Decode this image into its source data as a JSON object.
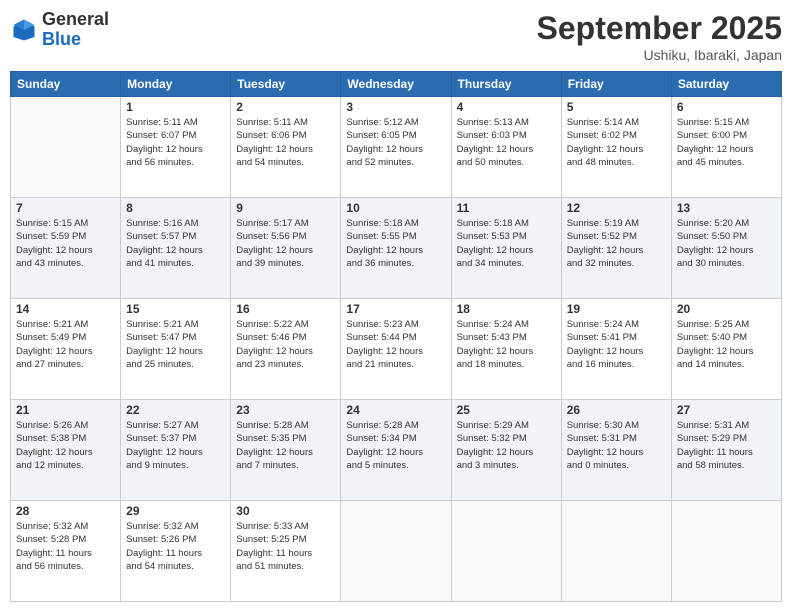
{
  "header": {
    "logo_general": "General",
    "logo_blue": "Blue",
    "month": "September 2025",
    "location": "Ushiku, Ibaraki, Japan"
  },
  "weekdays": [
    "Sunday",
    "Monday",
    "Tuesday",
    "Wednesday",
    "Thursday",
    "Friday",
    "Saturday"
  ],
  "weeks": [
    [
      {
        "day": "",
        "info": ""
      },
      {
        "day": "1",
        "info": "Sunrise: 5:11 AM\nSunset: 6:07 PM\nDaylight: 12 hours\nand 56 minutes."
      },
      {
        "day": "2",
        "info": "Sunrise: 5:11 AM\nSunset: 6:06 PM\nDaylight: 12 hours\nand 54 minutes."
      },
      {
        "day": "3",
        "info": "Sunrise: 5:12 AM\nSunset: 6:05 PM\nDaylight: 12 hours\nand 52 minutes."
      },
      {
        "day": "4",
        "info": "Sunrise: 5:13 AM\nSunset: 6:03 PM\nDaylight: 12 hours\nand 50 minutes."
      },
      {
        "day": "5",
        "info": "Sunrise: 5:14 AM\nSunset: 6:02 PM\nDaylight: 12 hours\nand 48 minutes."
      },
      {
        "day": "6",
        "info": "Sunrise: 5:15 AM\nSunset: 6:00 PM\nDaylight: 12 hours\nand 45 minutes."
      }
    ],
    [
      {
        "day": "7",
        "info": "Sunrise: 5:15 AM\nSunset: 5:59 PM\nDaylight: 12 hours\nand 43 minutes."
      },
      {
        "day": "8",
        "info": "Sunrise: 5:16 AM\nSunset: 5:57 PM\nDaylight: 12 hours\nand 41 minutes."
      },
      {
        "day": "9",
        "info": "Sunrise: 5:17 AM\nSunset: 5:56 PM\nDaylight: 12 hours\nand 39 minutes."
      },
      {
        "day": "10",
        "info": "Sunrise: 5:18 AM\nSunset: 5:55 PM\nDaylight: 12 hours\nand 36 minutes."
      },
      {
        "day": "11",
        "info": "Sunrise: 5:18 AM\nSunset: 5:53 PM\nDaylight: 12 hours\nand 34 minutes."
      },
      {
        "day": "12",
        "info": "Sunrise: 5:19 AM\nSunset: 5:52 PM\nDaylight: 12 hours\nand 32 minutes."
      },
      {
        "day": "13",
        "info": "Sunrise: 5:20 AM\nSunset: 5:50 PM\nDaylight: 12 hours\nand 30 minutes."
      }
    ],
    [
      {
        "day": "14",
        "info": "Sunrise: 5:21 AM\nSunset: 5:49 PM\nDaylight: 12 hours\nand 27 minutes."
      },
      {
        "day": "15",
        "info": "Sunrise: 5:21 AM\nSunset: 5:47 PM\nDaylight: 12 hours\nand 25 minutes."
      },
      {
        "day": "16",
        "info": "Sunrise: 5:22 AM\nSunset: 5:46 PM\nDaylight: 12 hours\nand 23 minutes."
      },
      {
        "day": "17",
        "info": "Sunrise: 5:23 AM\nSunset: 5:44 PM\nDaylight: 12 hours\nand 21 minutes."
      },
      {
        "day": "18",
        "info": "Sunrise: 5:24 AM\nSunset: 5:43 PM\nDaylight: 12 hours\nand 18 minutes."
      },
      {
        "day": "19",
        "info": "Sunrise: 5:24 AM\nSunset: 5:41 PM\nDaylight: 12 hours\nand 16 minutes."
      },
      {
        "day": "20",
        "info": "Sunrise: 5:25 AM\nSunset: 5:40 PM\nDaylight: 12 hours\nand 14 minutes."
      }
    ],
    [
      {
        "day": "21",
        "info": "Sunrise: 5:26 AM\nSunset: 5:38 PM\nDaylight: 12 hours\nand 12 minutes."
      },
      {
        "day": "22",
        "info": "Sunrise: 5:27 AM\nSunset: 5:37 PM\nDaylight: 12 hours\nand 9 minutes."
      },
      {
        "day": "23",
        "info": "Sunrise: 5:28 AM\nSunset: 5:35 PM\nDaylight: 12 hours\nand 7 minutes."
      },
      {
        "day": "24",
        "info": "Sunrise: 5:28 AM\nSunset: 5:34 PM\nDaylight: 12 hours\nand 5 minutes."
      },
      {
        "day": "25",
        "info": "Sunrise: 5:29 AM\nSunset: 5:32 PM\nDaylight: 12 hours\nand 3 minutes."
      },
      {
        "day": "26",
        "info": "Sunrise: 5:30 AM\nSunset: 5:31 PM\nDaylight: 12 hours\nand 0 minutes."
      },
      {
        "day": "27",
        "info": "Sunrise: 5:31 AM\nSunset: 5:29 PM\nDaylight: 11 hours\nand 58 minutes."
      }
    ],
    [
      {
        "day": "28",
        "info": "Sunrise: 5:32 AM\nSunset: 5:28 PM\nDaylight: 11 hours\nand 56 minutes."
      },
      {
        "day": "29",
        "info": "Sunrise: 5:32 AM\nSunset: 5:26 PM\nDaylight: 11 hours\nand 54 minutes."
      },
      {
        "day": "30",
        "info": "Sunrise: 5:33 AM\nSunset: 5:25 PM\nDaylight: 11 hours\nand 51 minutes."
      },
      {
        "day": "",
        "info": ""
      },
      {
        "day": "",
        "info": ""
      },
      {
        "day": "",
        "info": ""
      },
      {
        "day": "",
        "info": ""
      }
    ]
  ]
}
